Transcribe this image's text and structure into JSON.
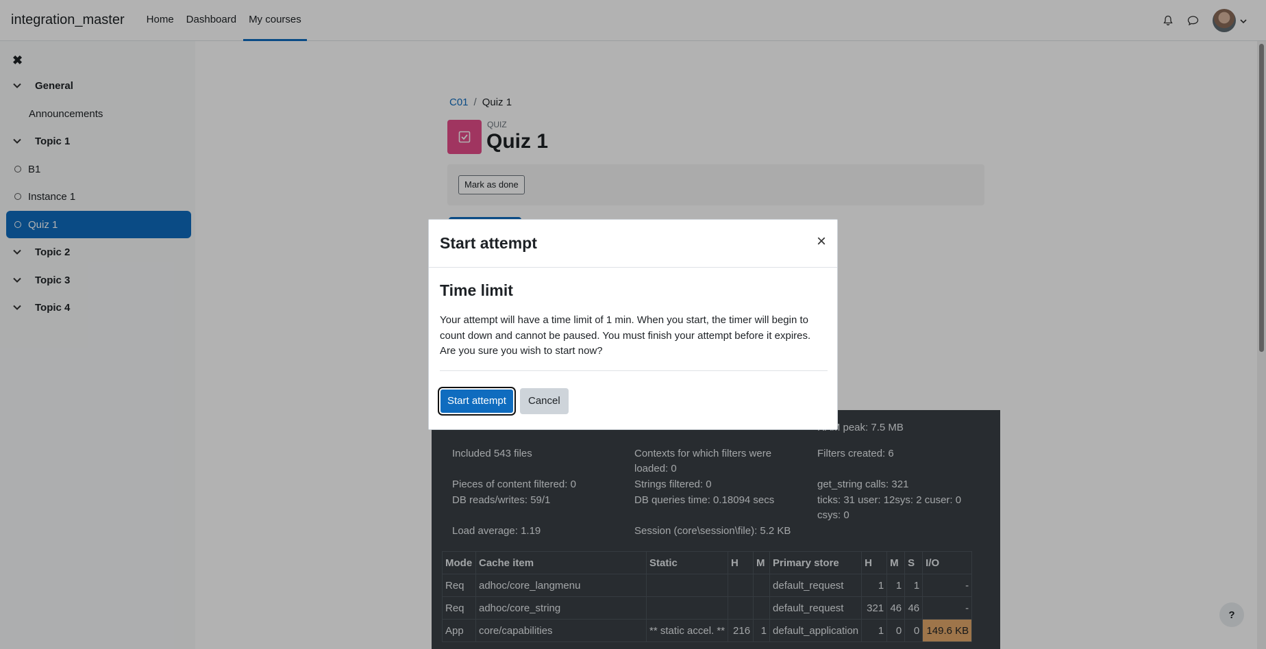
{
  "navbar": {
    "brand": "integration_master",
    "links": [
      "Home",
      "Dashboard",
      "My courses"
    ]
  },
  "drawer": {
    "close_icon": "×-icon",
    "items": [
      {
        "label": "General",
        "type": "section"
      },
      {
        "label": "Announcements",
        "type": "plain"
      },
      {
        "label": "Topic 1",
        "type": "section"
      },
      {
        "label": "B1",
        "type": "activity"
      },
      {
        "label": "Instance 1",
        "type": "activity"
      },
      {
        "label": "Quiz 1",
        "type": "activity",
        "active": true
      },
      {
        "label": "Topic 2",
        "type": "section"
      },
      {
        "label": "Topic 3",
        "type": "section"
      },
      {
        "label": "Topic 4",
        "type": "section"
      }
    ]
  },
  "breadcrumb": {
    "course": "C01",
    "sep": "/",
    "current": "Quiz 1"
  },
  "header": {
    "subtitle": "QUIZ",
    "title": "Quiz 1",
    "mark_done": "Mark as done"
  },
  "perf": {
    "items": [
      "RAM peak: 7.5 MB",
      "Included 543 files",
      "Contexts for which filters were loaded: 0",
      "Filters created: 6",
      "Pieces of content filtered: 0",
      "Strings filtered: 0",
      "get_string calls: 321",
      "DB reads/writes: 59/1",
      "DB queries time: 0.18094 secs",
      "ticks: 31 user: 12sys: 2 cuser: 0 csys: 0",
      "Load average: 1.19",
      "Session (core\\session\\file): 5.2 KB"
    ],
    "table": {
      "headers": [
        "Mode",
        "Cache item",
        "Static",
        "H",
        "M",
        "Primary store",
        "H",
        "M",
        "S",
        "I/O"
      ],
      "rows": [
        [
          "Req",
          "adhoc/core_langmenu",
          "",
          "",
          "",
          "default_request",
          "1",
          "1",
          "1",
          "-"
        ],
        [
          "Req",
          "adhoc/core_string",
          "",
          "",
          "",
          "default_request",
          "321",
          "46",
          "46",
          "-"
        ],
        [
          "App",
          "core/capabilities",
          "** static accel. **",
          "216",
          "1",
          "default_application",
          "1",
          "0",
          "0",
          "149.6 KB"
        ]
      ]
    }
  },
  "modal": {
    "title": "Start attempt",
    "close": "×",
    "heading": "Time limit",
    "text": "Your attempt will have a time limit of 1 min. When you start, the timer will begin to count down and cannot be paused. You must finish your attempt before it expires. Are you sure you wish to start now?",
    "primary": "Start attempt",
    "secondary": "Cancel"
  },
  "help": "?",
  "colors": {
    "accent": "#0f6cbf",
    "quiz": "#e64d8a",
    "perf_bg": "#3a4046",
    "io_highlight": "#e3a86a"
  }
}
